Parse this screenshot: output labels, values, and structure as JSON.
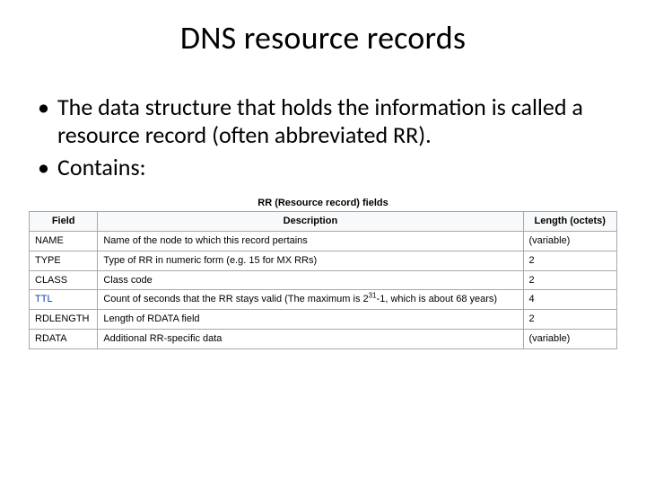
{
  "title": "DNS resource records",
  "bullets": [
    "The data structure that holds the information is called a resource record (often abbreviated RR).",
    "Contains:"
  ],
  "table": {
    "caption": "RR (Resource record) fields",
    "headers": {
      "field": "Field",
      "description": "Description",
      "length": "Length (octets)"
    },
    "rows": [
      {
        "field": "NAME",
        "field_link": false,
        "desc_html": "Name of the node to which this record pertains",
        "length": "(variable)"
      },
      {
        "field": "TYPE",
        "field_link": false,
        "desc_html": "Type of RR in numeric form (e.g. 15 for MX RRs)",
        "length": "2"
      },
      {
        "field": "CLASS",
        "field_link": false,
        "desc_html": "Class code",
        "length": "2"
      },
      {
        "field": "TTL",
        "field_link": true,
        "desc_html": "Count of seconds that the RR stays valid (The maximum is 2<sup>31</sup>-1, which is about 68 years)",
        "length": "4"
      },
      {
        "field": "RDLENGTH",
        "field_link": false,
        "desc_html": "Length of RDATA field",
        "length": "2"
      },
      {
        "field": "RDATA",
        "field_link": false,
        "desc_html": "Additional RR-specific data",
        "length": "(variable)"
      }
    ]
  }
}
